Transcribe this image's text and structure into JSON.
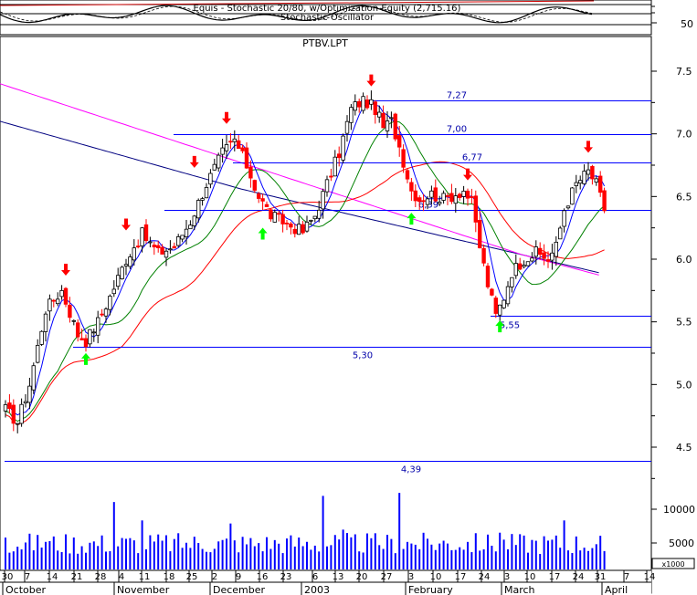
{
  "osc_panel": {
    "caption": "Equis - Stochastic 20/80, w/Optimization Equity (2,715.16)",
    "subcaption": "Stochastic Oscillator",
    "ytick": "50"
  },
  "price_panel": {
    "symbol": "PTBV.LPT",
    "yticks": [
      "7.5",
      "7.0",
      "6.5",
      "6.0",
      "5.5",
      "5.0",
      "4.5"
    ],
    "levels": [
      {
        "value": 7.27,
        "label": "7,27"
      },
      {
        "value": 7.0,
        "label": "7,00"
      },
      {
        "value": 6.77,
        "label": "6,77"
      },
      {
        "value": 6.39,
        "label": "6,39"
      },
      {
        "value": 5.55,
        "label": "5,55"
      },
      {
        "value": 5.3,
        "label": "5,30"
      },
      {
        "value": 4.39,
        "label": "4,39"
      }
    ]
  },
  "volume_panel": {
    "yticks": [
      "10000",
      "5000"
    ],
    "unit": "x1000"
  },
  "x_axis": {
    "days": [
      "30",
      "7",
      "14",
      "21",
      "28",
      "4",
      "11",
      "18",
      "25",
      "2",
      "9",
      "16",
      "23",
      "6",
      "13",
      "20",
      "27",
      "3",
      "10",
      "17",
      "24",
      "3",
      "10",
      "17",
      "24",
      "31",
      "7",
      "14"
    ],
    "months": [
      "October",
      "November",
      "December",
      "2003",
      "February",
      "March",
      "April"
    ]
  },
  "colors": {
    "up_candle": "#ffffff",
    "down_candle": "#ff0000",
    "sell_arrow": "#ff0000",
    "buy_arrow": "#00ff00",
    "level_line": "#0000ff",
    "ma_short": "#0000ff",
    "ma_mid": "#008000",
    "ma_long": "#ff0000",
    "ma_longest": "#ff00ff",
    "ma_200": "#000080",
    "volume": "#0000ff"
  },
  "chart_data": {
    "type": "candlestick",
    "y_range": [
      4.35,
      7.75
    ],
    "price_keypoints": [
      [
        0,
        4.8
      ],
      [
        3,
        4.7
      ],
      [
        6,
        5.0
      ],
      [
        10,
        5.6
      ],
      [
        14,
        5.75
      ],
      [
        18,
        5.4
      ],
      [
        20,
        5.35
      ],
      [
        23,
        5.5
      ],
      [
        26,
        5.7
      ],
      [
        30,
        6.0
      ],
      [
        34,
        6.2
      ],
      [
        38,
        6.05
      ],
      [
        42,
        6.1
      ],
      [
        46,
        6.3
      ],
      [
        50,
        6.6
      ],
      [
        54,
        6.85
      ],
      [
        57,
        6.95
      ],
      [
        60,
        6.75
      ],
      [
        63,
        6.5
      ],
      [
        66,
        6.35
      ],
      [
        69,
        6.3
      ],
      [
        72,
        6.25
      ],
      [
        74,
        6.22
      ],
      [
        77,
        6.35
      ],
      [
        80,
        6.6
      ],
      [
        83,
        6.85
      ],
      [
        86,
        7.2
      ],
      [
        89,
        7.27
      ],
      [
        92,
        7.2
      ],
      [
        94,
        7.05
      ],
      [
        96,
        7.1
      ],
      [
        98,
        6.9
      ],
      [
        101,
        6.55
      ],
      [
        103,
        6.48
      ],
      [
        106,
        6.52
      ],
      [
        109,
        6.48
      ],
      [
        112,
        6.52
      ],
      [
        114,
        6.55
      ],
      [
        116,
        6.45
      ],
      [
        118,
        6.1
      ],
      [
        120,
        5.8
      ],
      [
        122,
        5.55
      ],
      [
        124,
        5.7
      ],
      [
        126,
        5.9
      ],
      [
        129,
        6.0
      ],
      [
        132,
        6.05
      ],
      [
        135,
        6.0
      ],
      [
        137,
        6.1
      ],
      [
        139,
        6.4
      ],
      [
        142,
        6.6
      ],
      [
        145,
        6.7
      ],
      [
        147,
        6.6
      ],
      [
        149,
        6.4
      ]
    ],
    "buy_signals": [
      {
        "i": 20,
        "price": 5.28
      },
      {
        "i": 64,
        "price": 6.28
      },
      {
        "i": 101,
        "price": 6.4
      },
      {
        "i": 123,
        "price": 5.54
      }
    ],
    "sell_signals": [
      {
        "i": 15,
        "price": 5.84
      },
      {
        "i": 30,
        "price": 6.2
      },
      {
        "i": 47,
        "price": 6.7
      },
      {
        "i": 55,
        "price": 7.05
      },
      {
        "i": 91,
        "price": 7.35
      },
      {
        "i": 115,
        "price": 6.6
      },
      {
        "i": 145,
        "price": 6.82
      }
    ],
    "volume_range": [
      0,
      14000
    ],
    "volume_keypoints": [
      [
        0,
        5200
      ],
      [
        10,
        4500
      ],
      [
        27,
        11000
      ],
      [
        34,
        8000
      ],
      [
        56,
        7500
      ],
      [
        79,
        12000
      ],
      [
        84,
        6500
      ],
      [
        98,
        12500
      ],
      [
        123,
        6000
      ],
      [
        139,
        8000
      ],
      [
        149,
        3000
      ]
    ]
  }
}
